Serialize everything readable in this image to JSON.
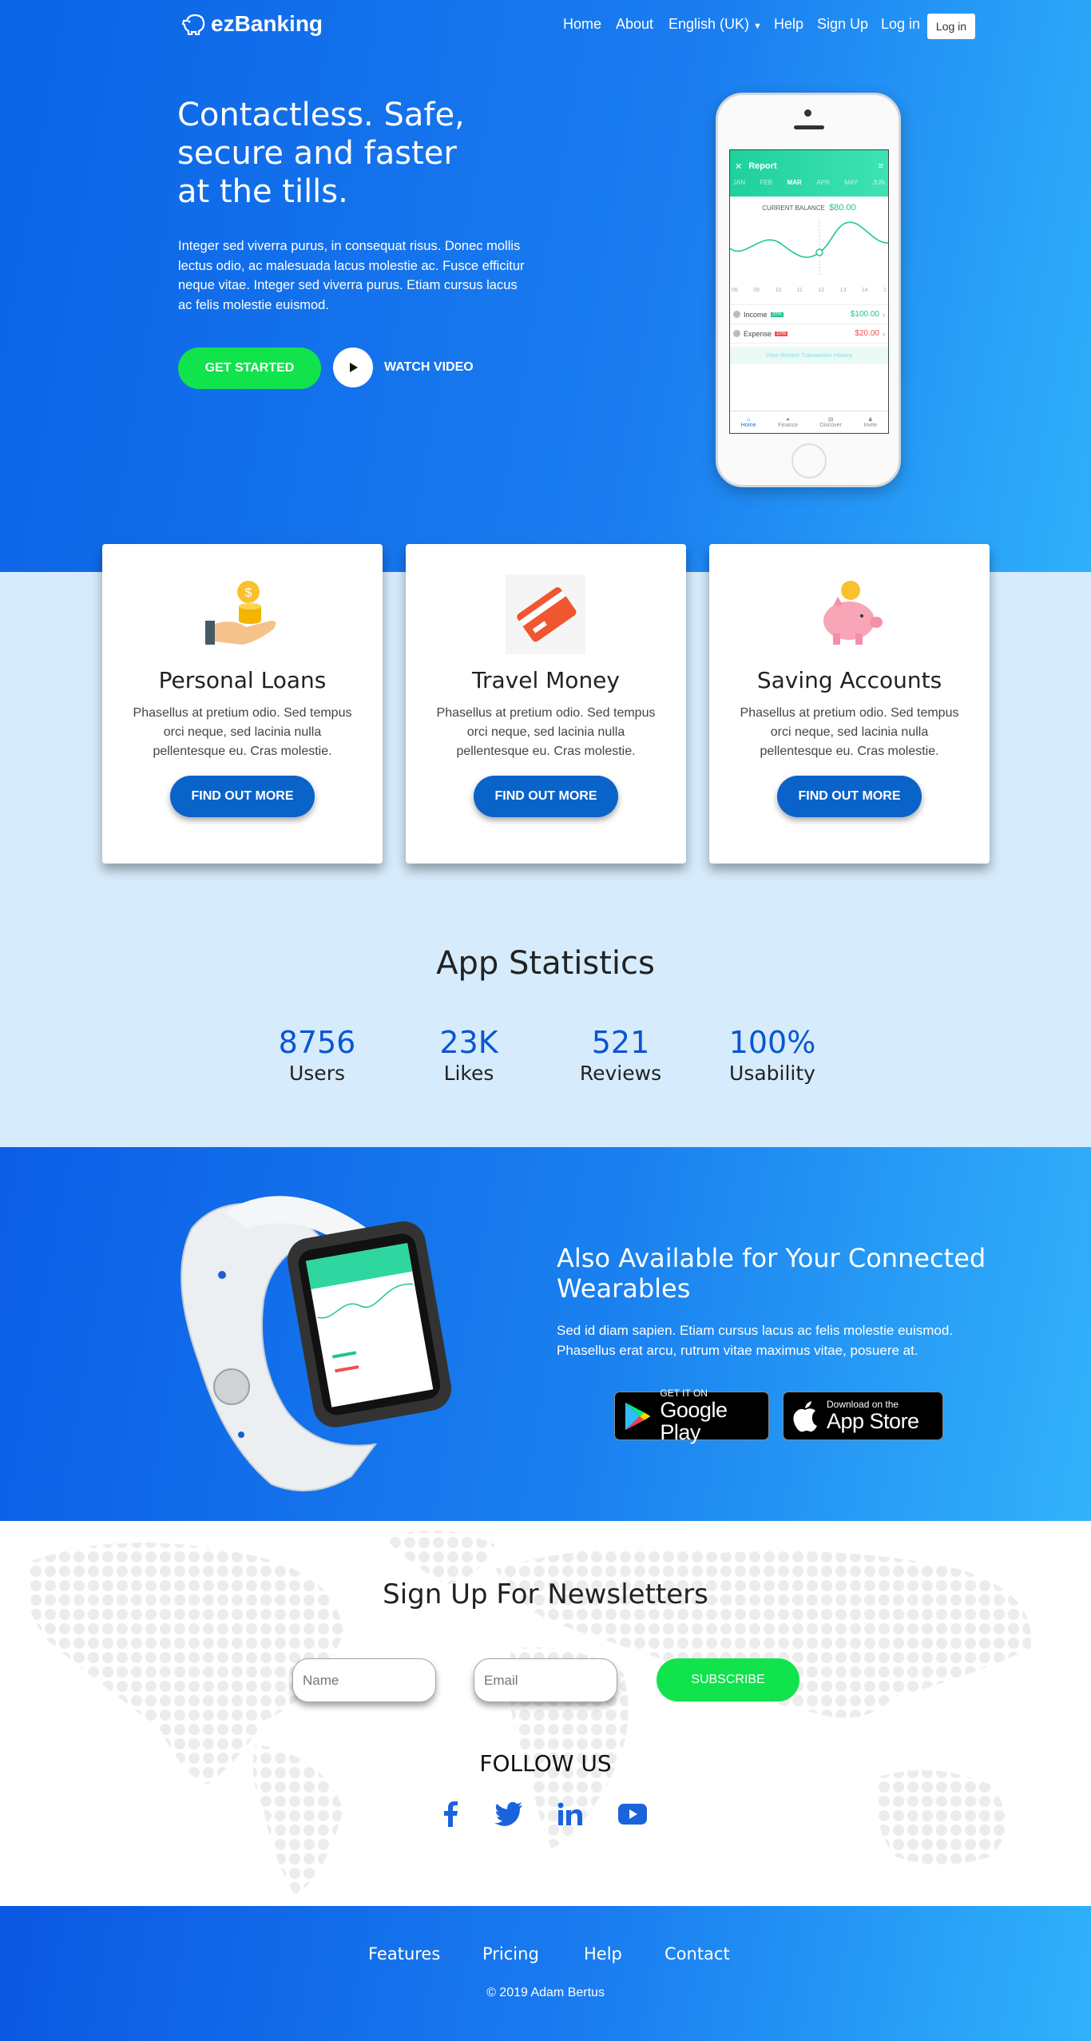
{
  "nav": {
    "brand": "ezBanking",
    "home": "Home",
    "about": "About",
    "language": "English (UK)",
    "help": "Help",
    "signup": "Sign Up",
    "login": "Log in",
    "login_button": "Log in"
  },
  "hero": {
    "title_lines": [
      "Contactless. Safe,",
      "secure and faster",
      "at the tills."
    ],
    "text": "Integer sed viverra purus, in consequat risus. Donec mollis lectus odio, ac malesuada lacus molestie ac. Fusce efficitur neque vitae. Integer sed viverra purus. Etiam cursus lacus ac felis molestie euismod.",
    "get_started": "GET STARTED",
    "watch_video": "WATCH VIDEO"
  },
  "phone_app": {
    "header": "Report",
    "months": [
      "JAN",
      "FEB",
      "MAR",
      "APR",
      "MAY",
      "JUN"
    ],
    "active_month": "MAR",
    "balance_label": "CURRENT BALANCE",
    "balance_value": "$80.00",
    "days": [
      "08",
      "09",
      "10",
      "11",
      "12",
      "13",
      "14",
      "1"
    ],
    "income_label": "Income",
    "income_badge": "20%",
    "income_value": "$100.00",
    "expense_label": "Expense",
    "expense_badge": "10%",
    "expense_value": "$20.00",
    "history_link": "View Recent Transaction History",
    "tabs": [
      "Home",
      "Finance",
      "Discover",
      "Invite"
    ]
  },
  "cards": [
    {
      "title": "Personal Loans",
      "text": "Phasellus at pretium odio. Sed tempus orci neque, sed lacinia nulla pellentesque eu. Cras molestie.",
      "button": "FIND OUT MORE",
      "icon": "coin-hand-icon"
    },
    {
      "title": "Travel Money",
      "text": "Phasellus at pretium odio. Sed tempus orci neque, sed lacinia nulla pellentesque eu. Cras molestie.",
      "button": "FIND OUT MORE",
      "icon": "credit-card-icon"
    },
    {
      "title": "Saving Accounts",
      "text": "Phasellus at pretium odio. Sed tempus orci neque, sed lacinia nulla pellentesque eu. Cras molestie.",
      "button": "FIND OUT MORE",
      "icon": "piggy-bank-icon"
    }
  ],
  "stats": {
    "title": "App Statistics",
    "items": [
      {
        "value": "8756",
        "label": "Users"
      },
      {
        "value": "23K",
        "label": "Likes"
      },
      {
        "value": "521",
        "label": "Reviews"
      },
      {
        "value": "100%",
        "label": "Usability"
      }
    ]
  },
  "wearables": {
    "title": "Also Available for Your Connected Wearables",
    "text": "Sed id diam sapien. Etiam cursus lacus ac felis molestie euismod. Phasellus erat arcu, rutrum vitae maximus vitae, posuere at.",
    "google_small": "GET IT ON",
    "google_large": "Google Play",
    "apple_small": "Download on the",
    "apple_large": "App Store"
  },
  "newsletter": {
    "title": "Sign Up For Newsletters",
    "name_placeholder": "Name",
    "email_placeholder": "Email",
    "subscribe": "SUBSCRIBE",
    "follow": "FOLLOW US",
    "social_icons": [
      "facebook-icon",
      "twitter-icon",
      "linkedin-icon",
      "youtube-icon"
    ]
  },
  "footer": {
    "links": [
      "Features",
      "Pricing",
      "Help",
      "Contact"
    ],
    "copyright": "© 2019 Adam Bertus"
  },
  "colors": {
    "primary_blue": "#0b63e6",
    "light_blue": "#2fb0fb",
    "cta_green": "#11e34c",
    "card_button": "#0a63c9",
    "stats_bg": "#d6ebfb",
    "stat_number": "#0a55d3"
  }
}
